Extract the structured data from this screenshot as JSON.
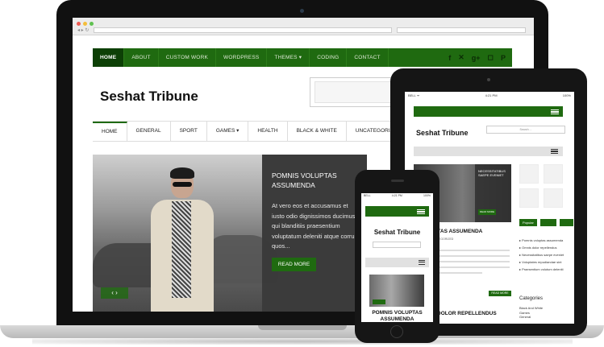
{
  "laptop": {
    "browser": {
      "nav_glyphs": "◂ ▸ ↻"
    },
    "topnav": {
      "items": [
        "HOME",
        "ABOUT",
        "CUSTOM WORK",
        "WORDPRESS",
        "THEMES ▾",
        "CODING",
        "CONTACT"
      ]
    },
    "social_icons": [
      {
        "name": "facebook-icon",
        "glyph": "f"
      },
      {
        "name": "twitter-icon",
        "glyph": "✕"
      },
      {
        "name": "googleplus-icon",
        "glyph": "g+"
      },
      {
        "name": "instagram-icon",
        "glyph": "◻"
      },
      {
        "name": "pinterest-icon",
        "glyph": "P"
      }
    ],
    "site_title": "Seshat Tribune",
    "mainnav": {
      "items": [
        "HOME",
        "GENERAL",
        "SPORT",
        "GAMES ▾",
        "HEALTH",
        "BLACK & WHITE",
        "UNCATEGORIZED"
      ]
    },
    "slider": {
      "title": "POMNIS VOLUPTAS ASSUMENDA",
      "excerpt": "At vero eos et accusamus et iusto odio dignissimos ducimus qui blanditiis praesentium voluptatum deleniti atque corrupti quos...",
      "button": "READ MORE",
      "arrows": "‹ ›"
    }
  },
  "tablet": {
    "status_left": "BELL ᯤ",
    "status_center": "4:21 PM",
    "status_right": "100%",
    "site_title": "Seshat Tribune",
    "search_placeholder": "Search ...",
    "slide_caption": "NECESSITATIBUS SAEPE EVENIET",
    "slide_button": "READ MORE",
    "post_title": "VOLUPTAS ASSUMENDA",
    "post_meta": "ADMIN   UNCATEGORIZED",
    "read_more": "READ MORE",
    "post2_title": "DOLOR REPELLENDUS",
    "tabs": [
      "Popular",
      "Recent",
      "Tags"
    ],
    "widget_list": [
      "Pomnis voluptas assumenda",
      "Omnis dolor repellendus",
      "Necessitatibus saepe eveniet",
      "Voluptates repudiandae sint",
      "Praesentium volutum deleniti"
    ],
    "categories_heading": "Categories",
    "categories": [
      "Black And White",
      "Games",
      "General"
    ]
  },
  "phone": {
    "status_left": "BELL",
    "status_center": "4:21 PM",
    "status_right": "100%",
    "site_title": "Seshat Tribune",
    "post_title": "POMNIS VOLUPTAS ASSUMENDA"
  },
  "colors": {
    "brand_green": "#1f6a10",
    "brand_green_dark": "#0d4006",
    "caption_bg": "#373737"
  }
}
